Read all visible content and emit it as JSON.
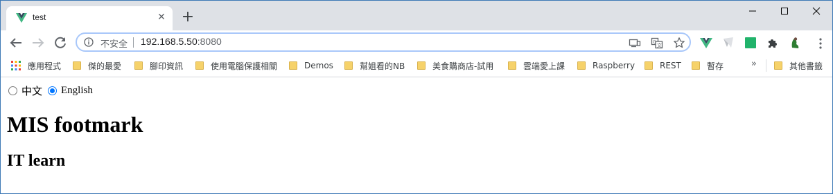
{
  "tab": {
    "title": "test",
    "close_glyph": "✕",
    "new_tab_glyph": "+"
  },
  "window_controls": [
    "minimize-icon",
    "maximize-icon",
    "close-icon"
  ],
  "toolbar": {
    "security_label": "不安全",
    "url_host": "192.168.5.50",
    "url_port": ":8080",
    "omnibox_icons": [
      "cast-icon",
      "translate-icon",
      "star-icon"
    ],
    "extensions": [
      "vue-devtools-icon",
      "extension-gray-icon",
      "green-square-icon",
      "puzzle-icon",
      "avatar-icon"
    ]
  },
  "bookmarks": {
    "items": [
      {
        "label": "應用程式",
        "icon": "apps-grid-icon"
      },
      {
        "label": "傑的最愛",
        "icon": "folder-icon"
      },
      {
        "label": "腳印資訊",
        "icon": "folder-icon"
      },
      {
        "label": "使用電腦保護相關",
        "icon": "folder-icon"
      },
      {
        "label": "Demos",
        "icon": "folder-icon"
      },
      {
        "label": "幫姐看的NB",
        "icon": "folder-icon"
      },
      {
        "label": "美食購商店-試用",
        "icon": "folder-icon"
      },
      {
        "label": "雲端愛上課",
        "icon": "folder-icon"
      },
      {
        "label": "Raspberry",
        "icon": "folder-icon"
      },
      {
        "label": "REST",
        "icon": "folder-icon"
      },
      {
        "label": "暫存",
        "icon": "folder-icon"
      }
    ],
    "more": "»",
    "other": "其他書籤"
  },
  "page": {
    "lang_options": [
      {
        "label": "中文",
        "checked": false
      },
      {
        "label": "English",
        "checked": true
      }
    ],
    "title": "MIS footmark",
    "subtitle": "IT learn"
  },
  "colors": {
    "accent": "#0075ff",
    "tabstrip": "#dee1e6",
    "folder": "#f6d26a",
    "vue_green": "#41b883",
    "vue_dark": "#35495e"
  }
}
